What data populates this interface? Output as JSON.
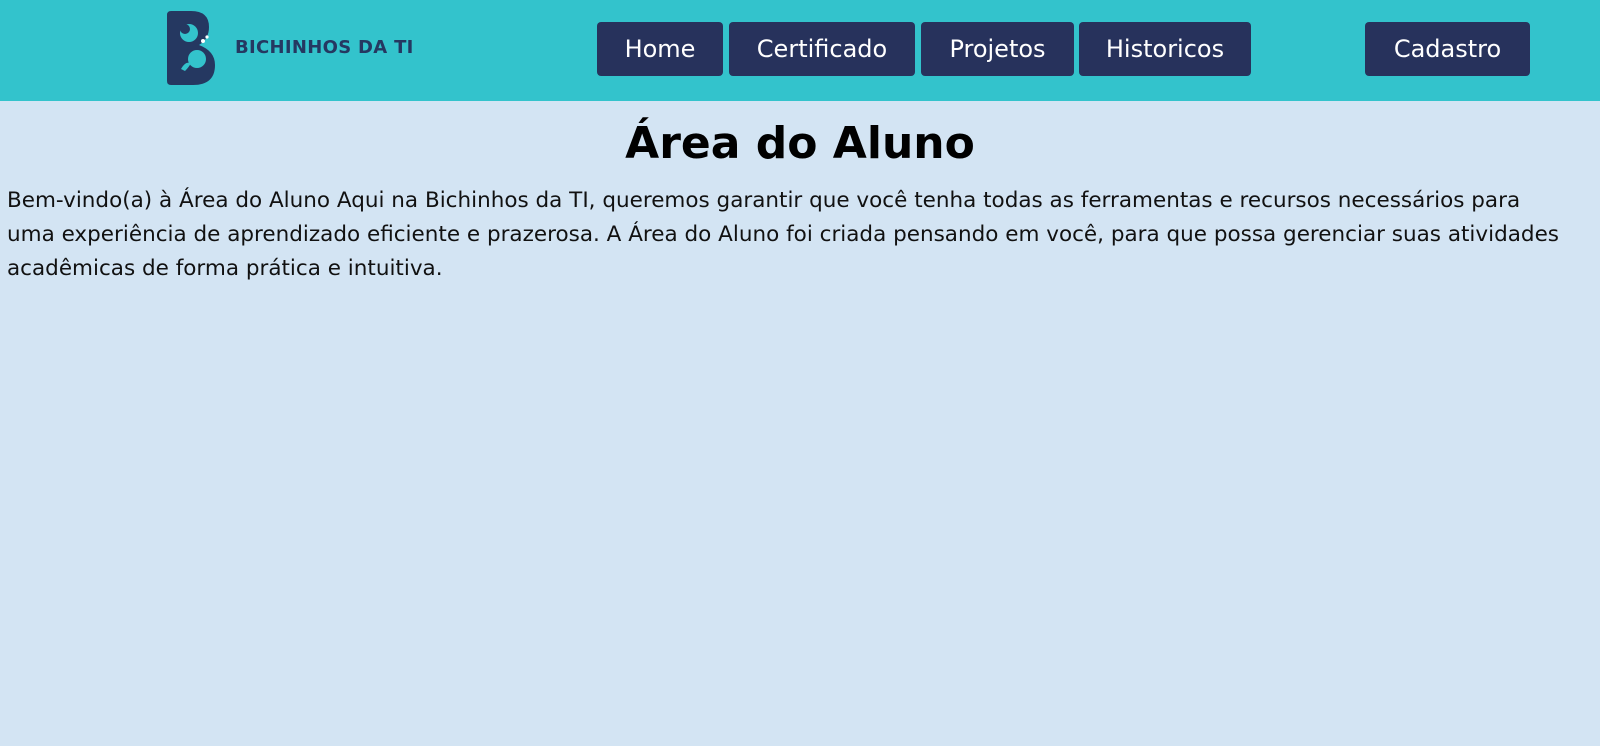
{
  "brand": {
    "logo_text": "BICHINHOS DA TI",
    "color": "#253861"
  },
  "nav": {
    "home": "Home",
    "certificado": "Certificado",
    "projetos": "Projetos",
    "historicos": "Historicos",
    "cadastro": "Cadastro"
  },
  "main": {
    "title": "Área do Aluno",
    "intro": "Bem-vindo(a) à Área do Aluno Aqui na Bichinhos da TI, queremos garantir que você tenha todas as ferramentas e recursos necessários para uma experiência de aprendizado eficiente e prazerosa. A Área do Aluno foi criada pensando em você, para que possa gerenciar suas atividades acadêmicas de forma prática e intuitiva."
  },
  "colors": {
    "header_bg": "#33c3cc",
    "page_bg": "#d3e4f3",
    "button_bg": "#27325c",
    "button_text": "#ffffff"
  }
}
